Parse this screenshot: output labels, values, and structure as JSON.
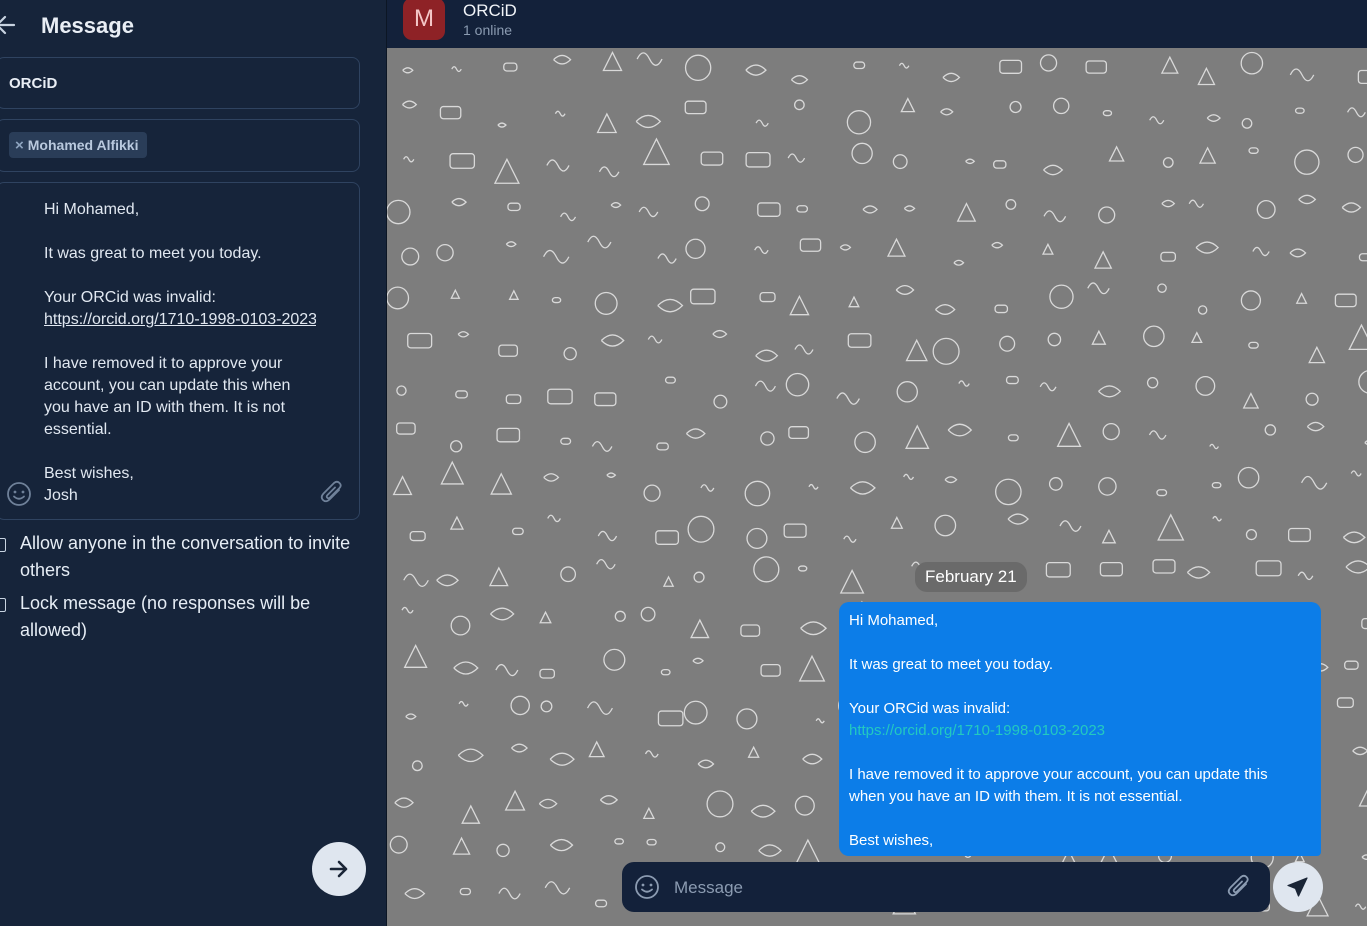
{
  "left_panel": {
    "title": "Message",
    "subject_value": "ORCiD",
    "recipients": [
      {
        "label": "Mohamed Alfikki",
        "remove_glyph": "×"
      }
    ],
    "body": {
      "part1": "Hi Mohamed,\n\nIt was great to meet you today.\n\nYour ORCid was invalid:",
      "link": "https://orcid.org/1710-1998-0103-2023",
      "part2": "\nI have removed it to approve your account, you can update this when you have an ID with them. It is not essential.\n\nBest wishes,\nJosh"
    },
    "options": {
      "allow_invite": "Allow anyone in the conversation to invite others",
      "lock_message": "Lock message (no responses will be allowed)"
    },
    "icons": [
      "back-arrow-icon",
      "emoji-icon",
      "paperclip-icon",
      "arrow-right-icon"
    ]
  },
  "chat": {
    "name": "ORCiD",
    "status": "1 online",
    "avatar_letter": "M",
    "date_label": "February 21",
    "message": {
      "part1": "Hi Mohamed,\n\nIt was great to meet you today.\n\nYour ORCid was invalid:\n",
      "link": "https://orcid.org/1710-1998-0103-2023",
      "part2": "\n\nI have removed it to approve your account, you can update this when you have an ID with them. It is not essential.\n\nBest wishes,\nJosh"
    },
    "composer_placeholder": "Message",
    "icons": [
      "emoji-icon",
      "paperclip-icon",
      "send-icon"
    ]
  },
  "colors": {
    "panel_bg": "#16243a",
    "chat_bg": "#7d7d7d",
    "bubble": "#0c7de8",
    "link": "#23c9c0",
    "avatar": "#8e2226"
  }
}
